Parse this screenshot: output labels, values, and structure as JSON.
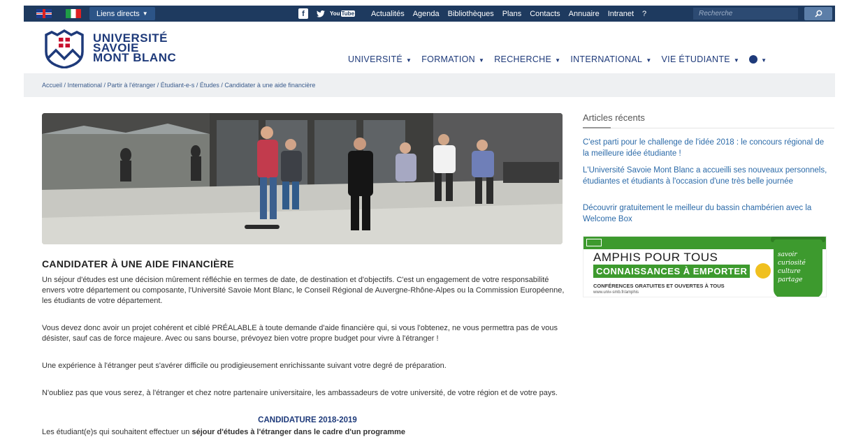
{
  "topbar": {
    "liens_label": "Liens directs",
    "youtube_label": "You",
    "youtube_box": "Tube",
    "links": [
      "Actualités",
      "Agenda",
      "Bibliothèques",
      "Plans",
      "Contacts",
      "Annuaire",
      "Intranet",
      "?"
    ],
    "search_placeholder": "Recherche"
  },
  "brand": {
    "line1": "UNIVERSITÉ",
    "line2": "SAVOIE",
    "line3": "MONT BLANC"
  },
  "nav": [
    "UNIVERSITÉ",
    "FORMATION",
    "RECHERCHE",
    "INTERNATIONAL",
    "VIE ÉTUDIANTE"
  ],
  "breadcrumb": "Accueil / International / Partir à l'étranger / Étudiant-e-s / Études / Candidater à une aide financière",
  "article": {
    "title": "CANDIDATER À UNE AIDE FINANCIÈRE",
    "p1": "Un séjour d'études est une décision mûrement réfléchie en termes de date, de destination et d'objectifs. C'est un engagement de votre responsabilité envers votre département ou composante, l'Université Savoie Mont Blanc, le Conseil Régional de Auvergne-Rhône-Alpes ou la Commission Européenne, les étudiants de votre département.",
    "p2": "Vous devez donc avoir un projet cohérent et ciblé PRÉALABLE à toute demande d'aide financière qui, si vous l'obtenez, ne vous permettra pas de vous désister, sauf cas de force majeure. Avec ou sans bourse, prévoyez bien votre propre budget pour vivre à l'étranger !",
    "p3": "Une expérience à l'étranger peut s'avérer difficile ou prodigieusement enrichissante suivant votre degré de préparation.",
    "p4": "N'oubliez pas que vous serez, à l'étranger et chez notre partenaire universitaire, les ambassadeurs de votre université, de votre région et de votre pays.",
    "subheading": "CANDIDATURE 2018-2019",
    "p5_start": "Les étudiant(e)s qui souhaitent effectuer un ",
    "p5_bold": "séjour d'études à l'étranger dans le cadre d'un programme"
  },
  "sidebar": {
    "title": "Articles récents",
    "articles": [
      "C'est parti pour le challenge de l'idée 2018 : le concours régional de la meilleure idée étudiante !",
      "L'Université Savoie Mont Blanc a accueilli ses nouveaux personnels, étudiantes et étudiants à l'occasion d'une très belle journée",
      "Découvrir gratuitement le meilleur du bassin chambérien avec la Welcome Box"
    ],
    "banner": {
      "title": "AMPHIS POUR TOUS",
      "subtitle": "CONNAISSANCES À EMPORTER",
      "line": "CONFÉRENCES GRATUITES ET OUVERTES À TOUS",
      "url": "www.univ-smb.fr/amphis",
      "cup_text": "savoir curiosité culture partage"
    }
  },
  "colors": {
    "topbar": "#1e3a5f",
    "brand": "#1e3a7a",
    "link": "#2b6aa8",
    "banner_green": "#3d9a2e"
  }
}
